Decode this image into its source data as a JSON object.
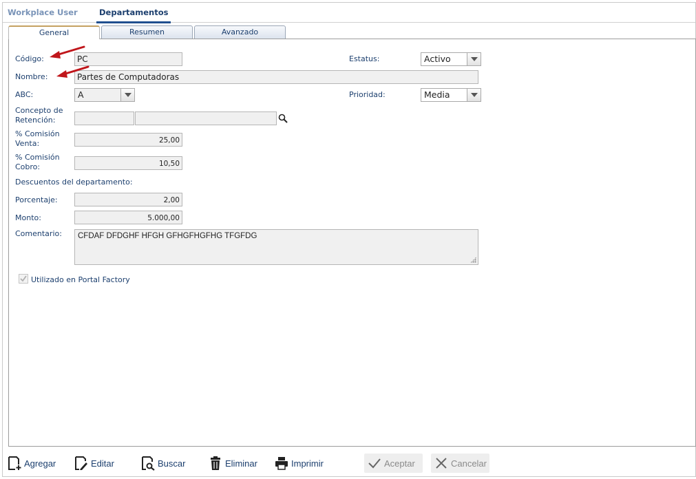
{
  "top_tabs": [
    {
      "label": "Workplace User",
      "active": false
    },
    {
      "label": "Departamentos",
      "active": true
    }
  ],
  "sub_tabs": [
    {
      "label": "General",
      "active": true
    },
    {
      "label": "Resumen",
      "active": false
    },
    {
      "label": "Avanzado",
      "active": false
    }
  ],
  "form": {
    "codigo_label": "Código:",
    "codigo_value": "PC",
    "nombre_label": "Nombre:",
    "nombre_value": "Partes de Computadoras",
    "abc_label": "ABC:",
    "abc_value": "A",
    "concepto_label_1": "Concepto de",
    "concepto_label_2": "Retención:",
    "concepto_code": "",
    "concepto_desc": "",
    "comision_venta_label_1": "% Comisión",
    "comision_venta_label_2": "Venta:",
    "comision_venta_value": "25,00",
    "comision_cobro_label_1": "% Comisión",
    "comision_cobro_label_2": "Cobro:",
    "comision_cobro_value": "10,50",
    "descuentos_label": "Descuentos del departamento:",
    "porcentaje_label": "Porcentaje:",
    "porcentaje_value": "2,00",
    "monto_label": "Monto:",
    "monto_value": "5.000,00",
    "comentario_label": "Comentario:",
    "comentario_value": "CFDAF DFDGHF HFGH GFHGFHGFHG TFGFDG",
    "estatus_label": "Estatus:",
    "estatus_value": "Activo",
    "prioridad_label": "Prioridad:",
    "prioridad_value": "Media",
    "portal_label": "Utilizado en Portal Factory",
    "portal_checked": true
  },
  "toolbar": {
    "agregar": "Agregar",
    "editar": "Editar",
    "buscar": "Buscar",
    "eliminar": "Eliminar",
    "imprimir": "Imprimir",
    "aceptar": "Aceptar",
    "cancelar": "Cancelar"
  },
  "colors": {
    "label_text": "#1c3f6e",
    "active_tab_accent": "#f0a830",
    "annotation_arrow": "#c0161b"
  },
  "icons": [
    "search-icon",
    "add-icon",
    "edit-icon",
    "search-doc-icon",
    "trash-icon",
    "printer-icon",
    "check-icon",
    "x-icon",
    "checkmark-icon",
    "resize-grip-icon"
  ]
}
